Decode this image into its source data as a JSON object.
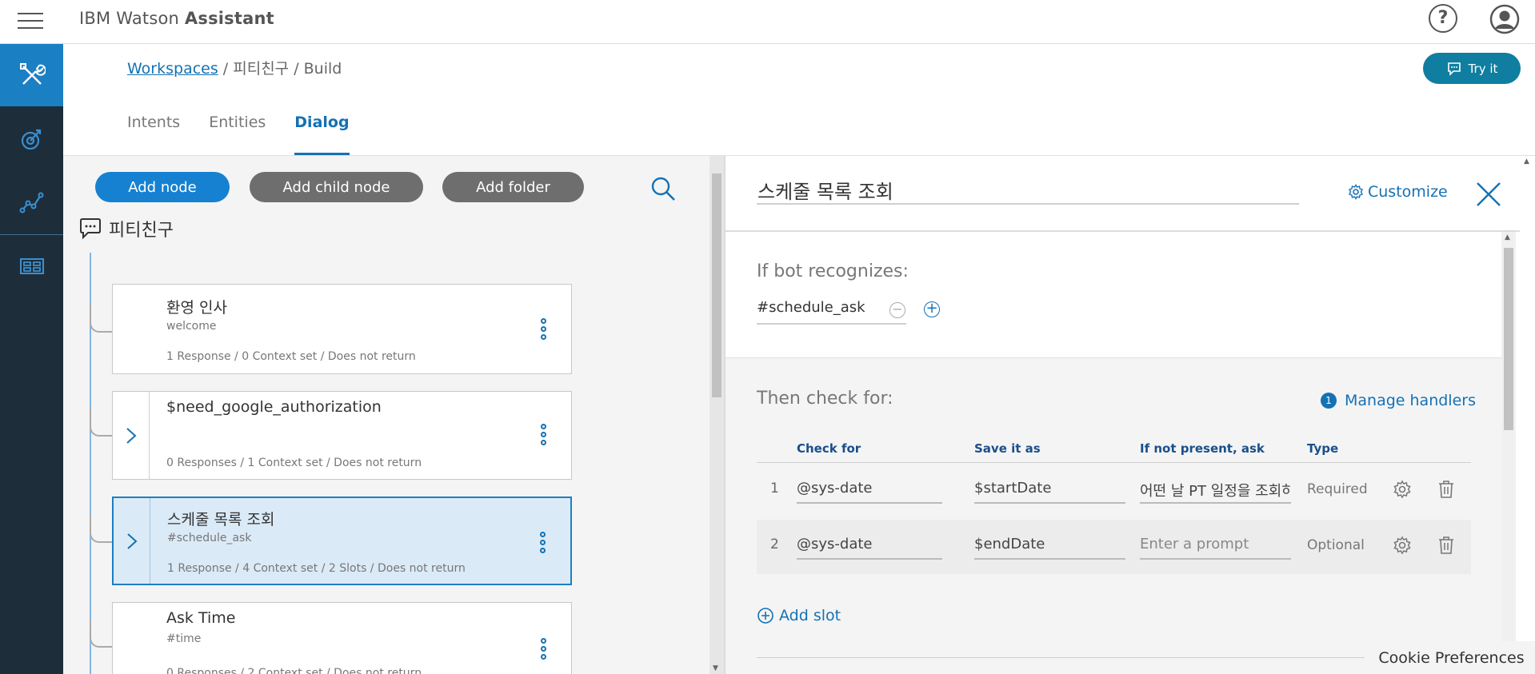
{
  "header": {
    "brand_light": "IBM Watson",
    "brand_bold": "Assistant",
    "help_symbol": "?"
  },
  "rail": {
    "items": [
      {
        "icon": "build-tools-icon",
        "active": true
      },
      {
        "icon": "improve-icon",
        "active": false
      },
      {
        "icon": "analytics-icon",
        "active": false
      },
      {
        "icon": "deploy-icon",
        "active": false
      }
    ]
  },
  "breadcrumb": {
    "link": "Workspaces",
    "rest": " / 피티친구 / Build"
  },
  "try_it": {
    "label": "Try it"
  },
  "tabs": [
    {
      "label": "Intents",
      "active": false
    },
    {
      "label": "Entities",
      "active": false
    },
    {
      "label": "Dialog",
      "active": true
    }
  ],
  "toolbar": {
    "add_node": "Add node",
    "add_child_node": "Add child node",
    "add_folder": "Add folder"
  },
  "tree": {
    "root_label": "피티친구",
    "nodes": [
      {
        "title": "환영 인사",
        "condition": "welcome",
        "meta": "1 Response / 0 Context set / Does not return",
        "has_children": false,
        "selected": false
      },
      {
        "title": "$need_google_authorization",
        "condition": "",
        "meta": "0 Responses / 1 Context set / Does not return",
        "has_children": true,
        "selected": false
      },
      {
        "title": "스케줄 목록 조회",
        "condition": "#schedule_ask",
        "meta": "1 Response / 4 Context set / 2 Slots / Does not return",
        "has_children": true,
        "selected": true
      },
      {
        "title": "Ask Time",
        "condition": "#time",
        "meta": "0 Responses / 2 Context set / Does not return",
        "has_children": false,
        "selected": false
      }
    ]
  },
  "detail": {
    "node_name": "스케줄 목록 조회",
    "customize": "Customize",
    "if_bot_recognizes": "If bot recognizes:",
    "condition": "#schedule_ask",
    "then_check_for": "Then check for:",
    "handlers_count": "1",
    "manage_handlers": "Manage handlers",
    "columns": {
      "check_for": "Check for",
      "save_as": "Save it as",
      "if_not_present": "If not present, ask",
      "type": "Type"
    },
    "slots": [
      {
        "num": "1",
        "check_for": "@sys-date",
        "save_as": "$startDate",
        "prompt": "어떤 날 PT 일정을 조회하시겠어요?",
        "prompt_placeholder": false,
        "type": "Required"
      },
      {
        "num": "2",
        "check_for": "@sys-date",
        "save_as": "$endDate",
        "prompt": "Enter a prompt",
        "prompt_placeholder": true,
        "type": "Optional"
      }
    ],
    "add_slot": "Add slot"
  },
  "cookie": {
    "label": "Cookie Preferences"
  },
  "colors": {
    "rail_bg": "#1d2d3a",
    "rail_active": "#1b7fc4",
    "accent_blue": "#1471b4",
    "try_it_bg": "#0f7ea0",
    "node_selected_bg": "#dbeaf7"
  }
}
